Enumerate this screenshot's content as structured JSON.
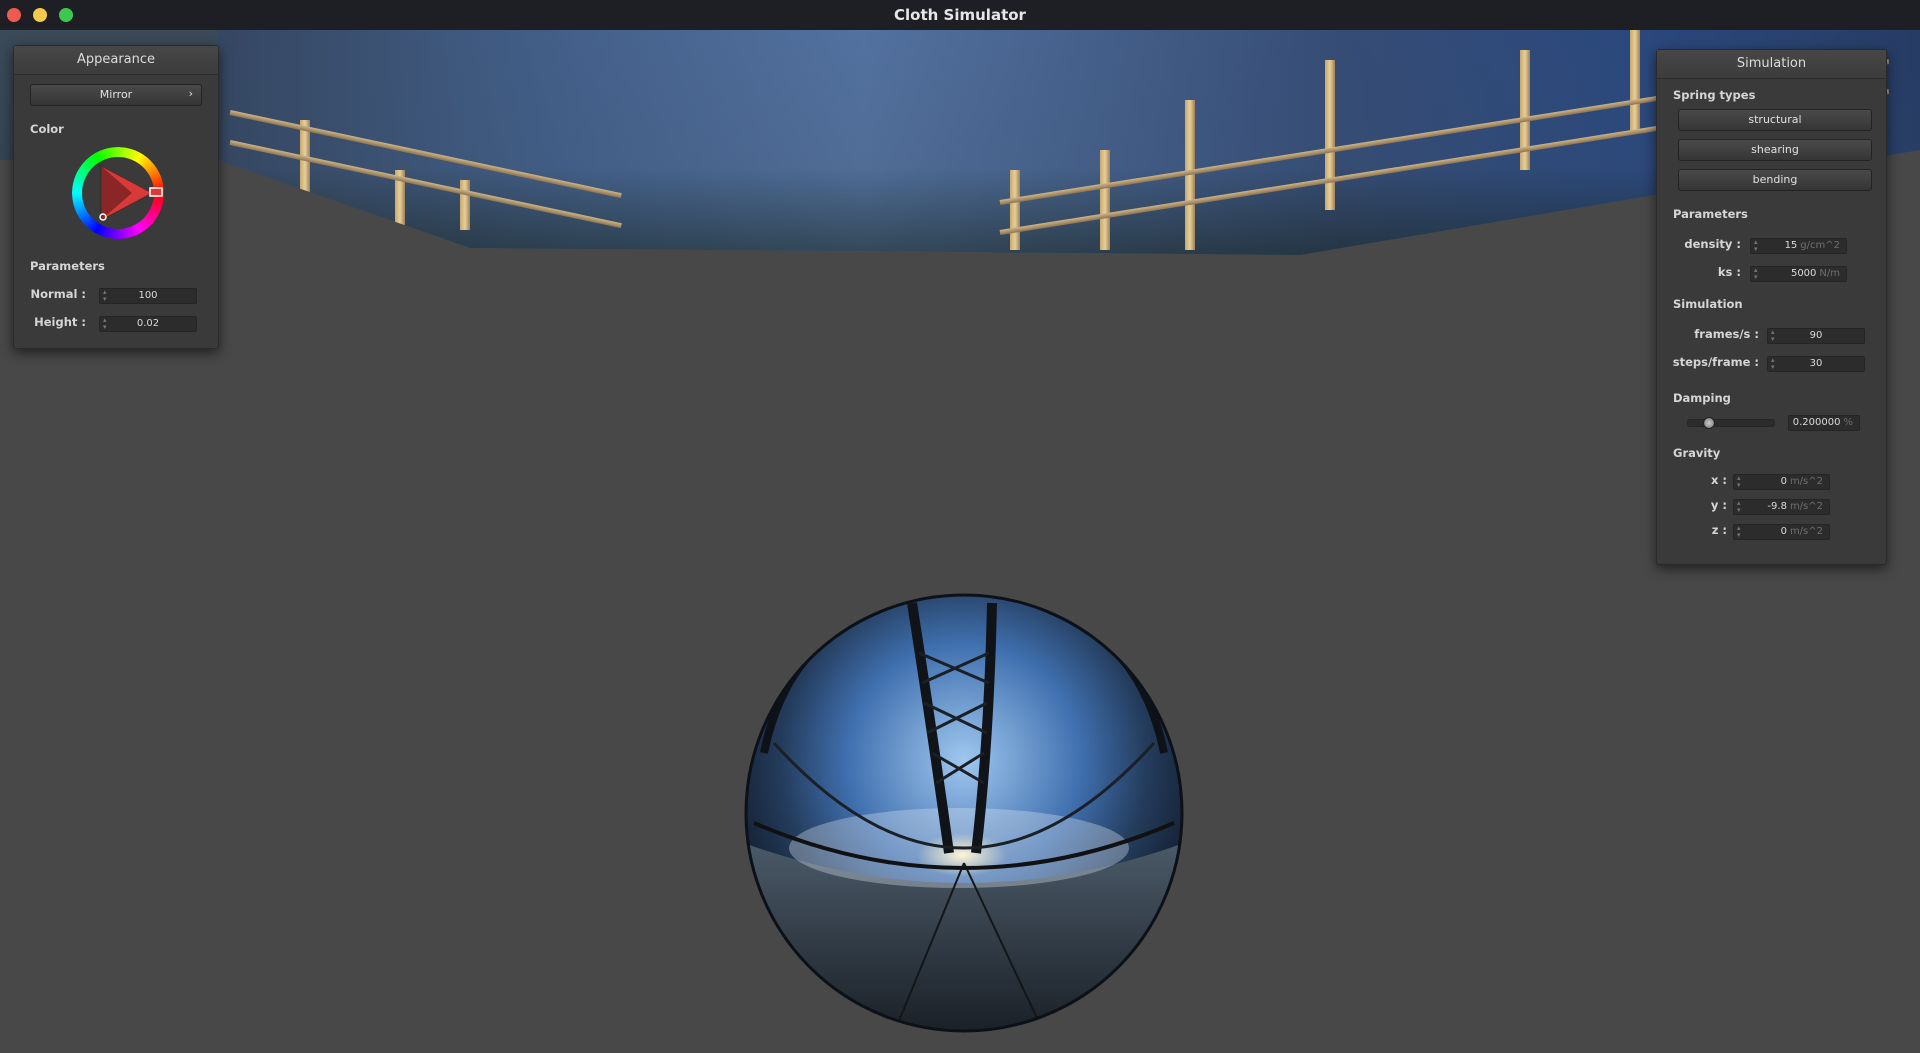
{
  "window": {
    "title": "Cloth Simulator"
  },
  "appearance": {
    "header": "Appearance",
    "material": "Mirror",
    "material_arrow": "›",
    "color_label": "Color",
    "params_label": "Parameters",
    "normal_label": "Normal :",
    "normal_value": "100",
    "height_label": "Height :",
    "height_value": "0.02"
  },
  "simulation": {
    "header": "Simulation",
    "spring_types_label": "Spring types",
    "spring_types": [
      "structural",
      "shearing",
      "bending"
    ],
    "params_label": "Parameters",
    "density_label": "density :",
    "density_value": "15",
    "density_unit": "g/cm^2",
    "ks_label": "ks :",
    "ks_value": "5000",
    "ks_unit": "N/m",
    "sim_label": "Simulation",
    "fps_label": "frames/s :",
    "fps_value": "90",
    "steps_label": "steps/frame :",
    "steps_value": "30",
    "damping_label": "Damping",
    "damping_value": "0.200000",
    "damping_unit": "%",
    "damping_fraction": 0.2,
    "gravity_label": "Gravity",
    "gx_label": "x :",
    "gx_value": "0",
    "gy_label": "y :",
    "gy_value": "-9.8",
    "gz_label": "z :",
    "gz_value": "0",
    "g_unit": "m/s^2"
  },
  "colors": {
    "accent_red": "#d83a3a",
    "panel": "#3a3a3a",
    "background": "#484848"
  }
}
